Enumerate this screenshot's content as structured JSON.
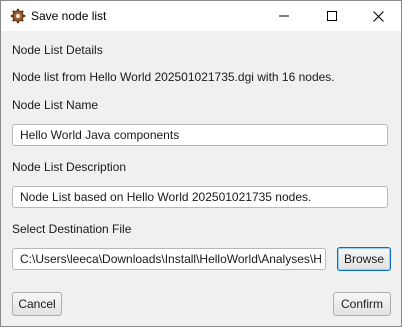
{
  "window": {
    "title": "Save node list",
    "icon": "gear-app-icon",
    "controls": [
      "minimize-icon",
      "maximize-icon",
      "close-icon"
    ]
  },
  "details": {
    "heading": "Node List Details",
    "summary": "Node list from Hello World 202501021735.dgi with 16 nodes."
  },
  "name_field": {
    "label": "Node List Name",
    "value": "Hello World Java components"
  },
  "description_field": {
    "label": "Node List Description",
    "value": "Node List based on Hello World 202501021735 nodes."
  },
  "destination": {
    "label": "Select Destination File",
    "path": "C:\\Users\\leeca\\Downloads\\Install\\HelloWorld\\Analyses\\H",
    "browse_label": "Browse"
  },
  "footer": {
    "cancel_label": "Cancel",
    "confirm_label": "Confirm"
  },
  "colors": {
    "focus_border": "#0a6fc2",
    "background": "#f0f0f0"
  }
}
